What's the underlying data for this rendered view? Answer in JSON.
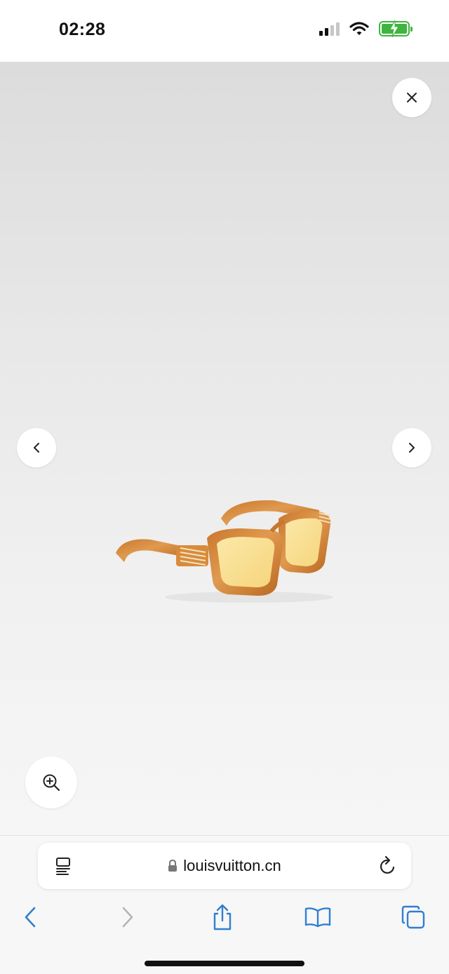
{
  "status_bar": {
    "time": "02:28",
    "icons": [
      "cellular-signal-icon",
      "wifi-icon",
      "battery-charging-icon"
    ],
    "battery_color": "#3fb43f"
  },
  "viewer": {
    "close_icon": "close-icon",
    "prev_icon": "chevron-left-icon",
    "next_icon": "chevron-right-icon",
    "zoom_icon": "zoom-in-icon",
    "product_image": "tortoiseshell-sunglasses-yellow-lenses"
  },
  "browser": {
    "url": "louisvuitton.cn",
    "lock_icon": "lock-icon",
    "reader_icon": "reader-mode-icon",
    "reload_icon": "reload-icon",
    "toolbar": [
      "back-icon",
      "forward-icon",
      "share-icon",
      "bookmarks-icon",
      "tabs-icon"
    ],
    "accent_color": "#2f7fd1"
  }
}
